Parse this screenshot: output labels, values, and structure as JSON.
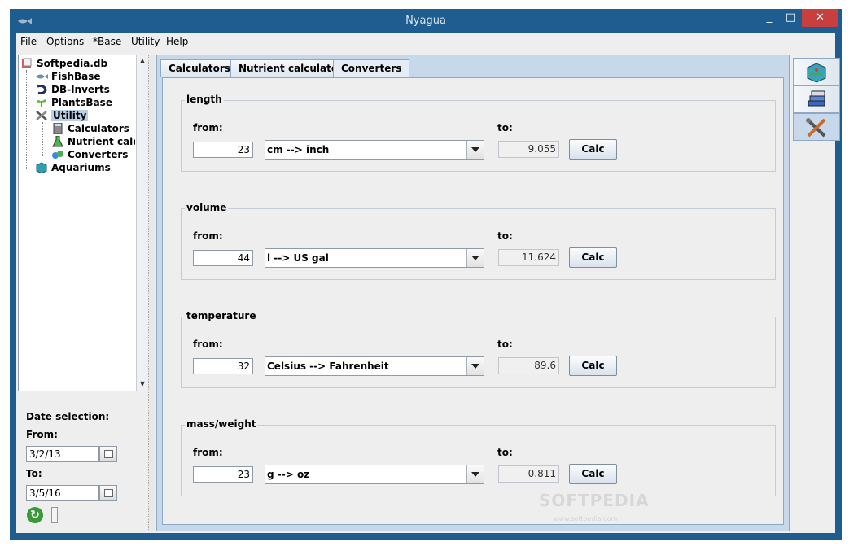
{
  "window": {
    "title": "Nyagua",
    "min": "_",
    "max": "□",
    "close": "✕"
  },
  "menu": [
    "File",
    "Options",
    "*Base",
    "Utility",
    "Help"
  ],
  "tree": {
    "root": "Softpedia.db",
    "items": [
      "FishBase",
      "DB-Inverts",
      "PlantsBase",
      "Utility",
      "Calculators",
      "Nutrient calculator",
      "Converters",
      "Aquariums"
    ]
  },
  "date": {
    "title": "Date selection:",
    "from_label": "From:",
    "from_value": "3/2/13",
    "to_label": "To:",
    "to_value": "3/5/16"
  },
  "tabs": [
    "Calculators",
    "Nutrient calculator",
    "Converters"
  ],
  "active_tab": "Converters",
  "converters": [
    {
      "title": "length",
      "from_label": "from:",
      "to_label": "to:",
      "from_value": "23",
      "unit": "cm --> inch",
      "result": "9.055",
      "button": "Calc"
    },
    {
      "title": "volume",
      "from_label": "from:",
      "to_label": "to:",
      "from_value": "44",
      "unit": "l --> US gal",
      "result": "11.624",
      "button": "Calc"
    },
    {
      "title": "temperature",
      "from_label": "from:",
      "to_label": "to:",
      "from_value": "32",
      "unit": "Celsius --> Fahrenheit",
      "result": "89.6",
      "button": "Calc"
    },
    {
      "title": "mass/weight",
      "from_label": "from:",
      "to_label": "to:",
      "from_value": "23",
      "unit": "g --> oz",
      "result": "0.811",
      "button": "Calc"
    }
  ],
  "side_tabs": [
    "aquarium-icon",
    "books-icon",
    "tools-icon"
  ],
  "watermark": {
    "text": "SOFTPEDIA",
    "url": "www.softpedia.com"
  },
  "colors": {
    "titlebar": "#1f5d91",
    "panel": "#c7d8ea",
    "close": "#c73f3f"
  }
}
